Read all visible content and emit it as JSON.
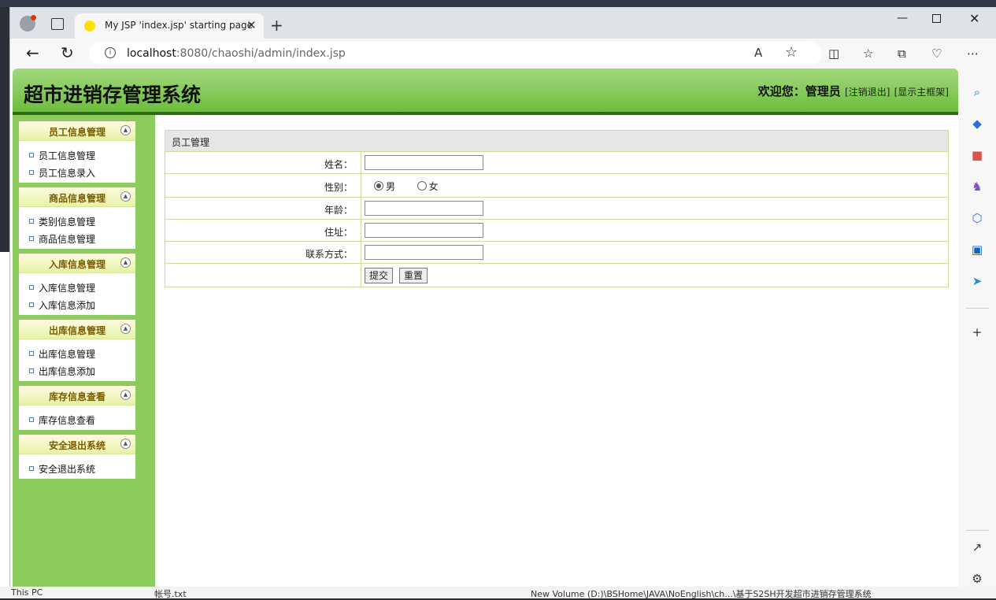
{
  "browser": {
    "tab_title": "My JSP 'index.jsp' starting page",
    "url_host": "localhost",
    "url_path": ":8080/chaoshi/admin/index.jsp"
  },
  "taskbar": {
    "item1": "This PC",
    "item2": "帐号.txt",
    "item3": "New Volume (D:)\\BSHome\\JAVA\\NoEnglish\\ch...\\基于S2SH开发超市进销存管理系统"
  },
  "header": {
    "title": "超市进销存管理系统",
    "welcome": "欢迎您：",
    "user": "管理员",
    "logout": "[注销退出]",
    "show_frame": "[显示主框架]"
  },
  "menu": [
    {
      "title": "员工信息管理",
      "items": [
        "员工信息管理",
        "员工信息录入"
      ]
    },
    {
      "title": "商品信息管理",
      "items": [
        "类别信息管理",
        "商品信息管理"
      ]
    },
    {
      "title": "入库信息管理",
      "items": [
        "入库信息管理",
        "入库信息添加"
      ]
    },
    {
      "title": "出库信息管理",
      "items": [
        "出库信息管理",
        "出库信息添加"
      ]
    },
    {
      "title": "库存信息查看",
      "items": [
        "库存信息查看"
      ]
    },
    {
      "title": "安全退出系统",
      "items": [
        "安全退出系统"
      ]
    }
  ],
  "form": {
    "heading": "员工管理",
    "name_label": "姓名：",
    "gender_label": "性别：",
    "gender_male": "男",
    "gender_female": "女",
    "gender_selected": "男",
    "age_label": "年龄：",
    "address_label": "住址：",
    "contact_label": "联系方式：",
    "submit": "提交",
    "reset": "重置"
  }
}
